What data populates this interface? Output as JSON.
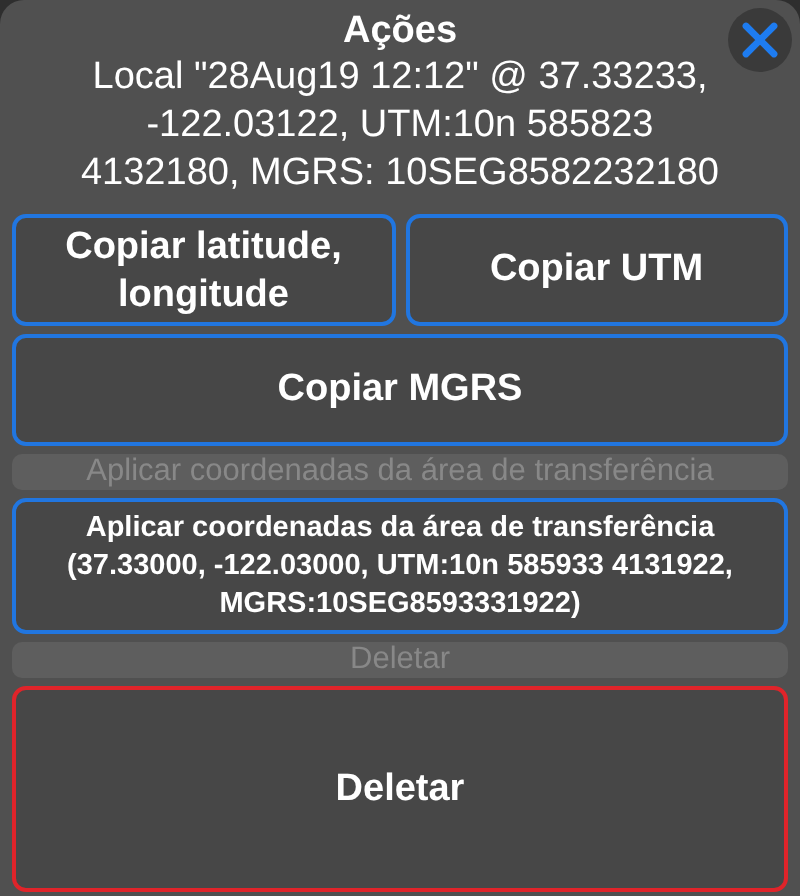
{
  "title": "Ações",
  "description": "Local \"28Aug19 12:12\" @ 37.33233, -122.03122, UTM:10n 585823 4132180, MGRS: 10SEG8582232180",
  "items": [
    {
      "kind": "button_row",
      "buttons": [
        "Copiar latitude, longitude",
        "Copiar UTM"
      ]
    },
    {
      "kind": "button",
      "label": "Copiar MGRS"
    },
    {
      "kind": "header",
      "label": "Aplicar coordenadas da área de transferência"
    },
    {
      "kind": "detail_button",
      "label": "Aplicar coordenadas da área de transferência (37.33000, -122.03000, UTM:10n 585933 4131922, MGRS:10SEG8593331922)"
    },
    {
      "kind": "header",
      "label": "Deletar"
    },
    {
      "kind": "destructive_button",
      "label": "Deletar"
    }
  ]
}
